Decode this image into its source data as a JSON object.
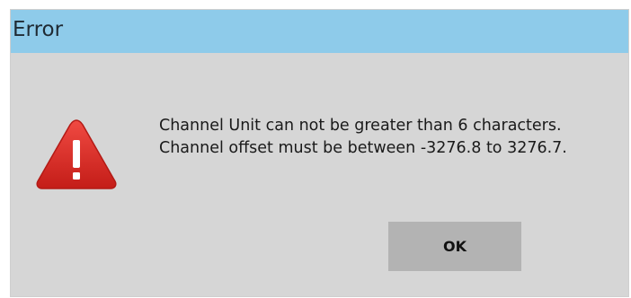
{
  "dialog": {
    "title": "Error",
    "icon": "warning-icon",
    "messages": [
      "Channel Unit can not be greater than 6 characters.",
      "Channel offset must be between -3276.8 to 3276.7."
    ],
    "ok_label": "OK"
  },
  "colors": {
    "titlebar": "#8ecbea",
    "background": "#d6d6d6",
    "button": "#b3b3b3",
    "warning": "#e0312b"
  }
}
